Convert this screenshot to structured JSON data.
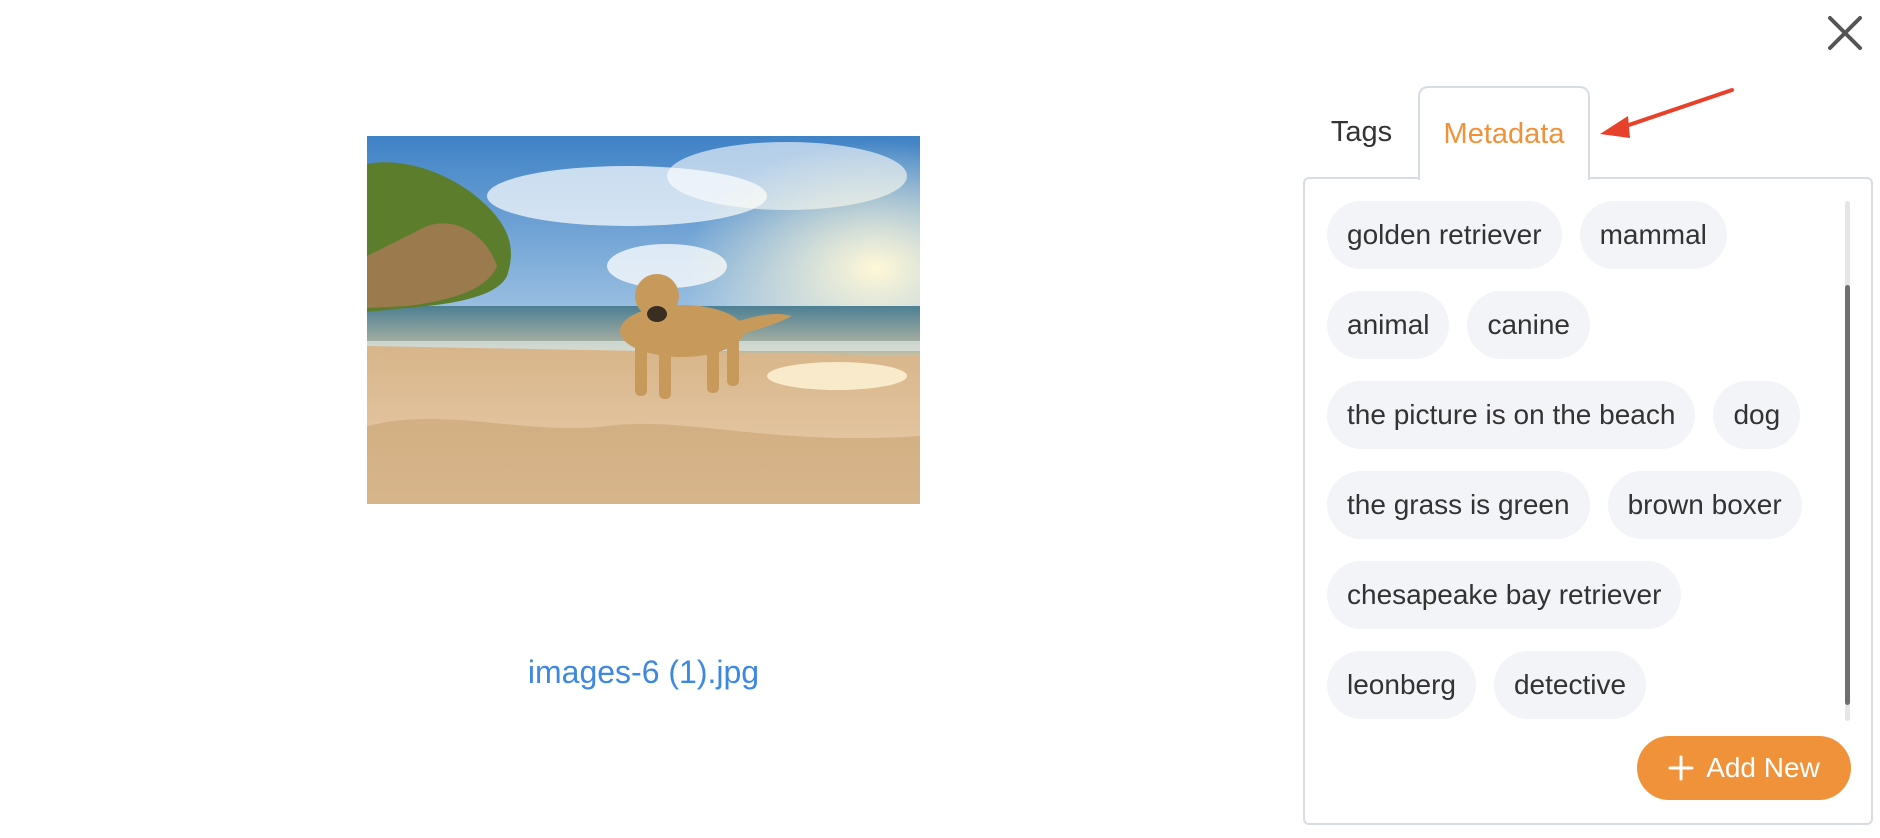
{
  "file": {
    "name": "images-6 (1).jpg"
  },
  "tabs": [
    {
      "label": "Tags",
      "active": false
    },
    {
      "label": "Metadata",
      "active": true
    }
  ],
  "metadata_tags": [
    "golden retriever",
    "mammal",
    "animal",
    "canine",
    "the picture is on the beach",
    "dog",
    "the grass is green",
    "brown boxer",
    "chesapeake bay retriever",
    "leonberg",
    "detective"
  ],
  "actions": {
    "add_new_label": "Add New"
  },
  "icons": {
    "close": "close-icon",
    "plus": "plus-icon",
    "annotation_arrow": "arrow-icon"
  },
  "colors": {
    "accent": "#f0923a",
    "link": "#3d88e0",
    "annotation": "#e8412b",
    "chip_bg": "#f3f4f7"
  }
}
